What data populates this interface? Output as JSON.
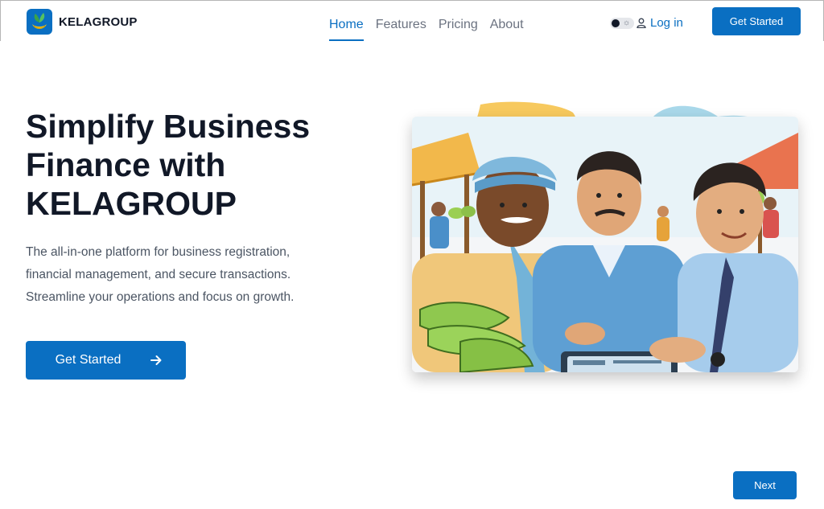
{
  "header": {
    "brand": "KELAGROUP",
    "nav": [
      {
        "label": "Home",
        "active": true
      },
      {
        "label": "Features",
        "active": false
      },
      {
        "label": "Pricing",
        "active": false
      },
      {
        "label": "About",
        "active": false
      }
    ],
    "login_label": "Log in",
    "cta_label": "Get Started"
  },
  "hero": {
    "title_line1": "Simplify Business",
    "title_line2": "Finance with",
    "title_line3": "KELAGROUP",
    "subtitle_line1": "The all-in-one platform for business registration,",
    "subtitle_line2": "financial management, and secure transactions.",
    "subtitle_line3": "Streamline your operations and focus on growth.",
    "cta_label": "Get Started"
  },
  "footer": {
    "next_label": "Next"
  },
  "colors": {
    "accent": "#0a6fc2",
    "heading": "#111827",
    "body_text": "#4b5563",
    "nav_inactive": "#6b7280"
  },
  "icons": {
    "logo": "banana-plant-logo-icon",
    "theme": "sun-icon",
    "login": "user-icon",
    "cta": "arrow-right-icon"
  }
}
